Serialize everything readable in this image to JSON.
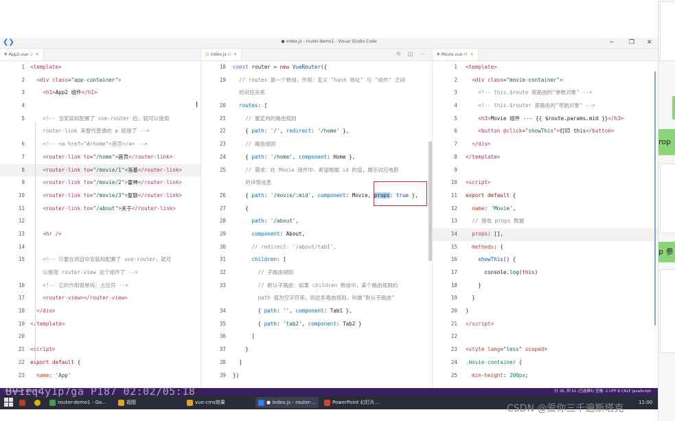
{
  "window": {
    "title": "● index.js - router-demo1 - Visual Studio Code",
    "controls": [
      "─",
      "❐",
      "✕"
    ]
  },
  "panes": [
    {
      "tab": {
        "icon": "▼",
        "label": "App2.vue",
        "status": "U",
        "close": "✕"
      },
      "lines": [
        {
          "n": "1",
          "html": "<span class='tag'>&lt;template&gt;</span>"
        },
        {
          "n": "2",
          "html": "  <span class='tag'>&lt;div</span> <span class='attr'>class</span>=<span class='str'>\"app-container\"</span><span class='tag'>&gt;</span>"
        },
        {
          "n": "3",
          "html": "    <span class='tag'>&lt;h1&gt;</span>App2 组件<span class='tag'>&lt;/h1&gt;</span>"
        },
        {
          "n": "4",
          "html": ""
        },
        {
          "n": "5",
          "html": "    <span class='cm'>&lt;!-- 当安装和配置了 vue-router 后，就可以使用</span>"
        },
        {
          "n": "",
          "html": "    <span class='cm'>router-link 来替代普通的 a 链接了 --&gt;</span>"
        },
        {
          "n": "6",
          "html": "    <span class='cm'>&lt;!-- &lt;a href=\"#/home\"&gt;首页&lt;/a&gt; --&gt;</span>"
        },
        {
          "n": "7",
          "html": "    <span class='tag'>&lt;router-link</span> <span class='attr'>to</span>=<span class='str'>\"/home\"</span><span class='tag'>&gt;</span>首页<span class='tag'>&lt;/router-link&gt;</span>"
        },
        {
          "n": "8",
          "html": "    <span class='tag'>&lt;router-link</span> <span class='attr'>to</span>=<span class='str'>\"/movie/1\"</span><span class='tag'>&gt;</span>洛基<span class='tag'>&lt;/router-link&gt;</span>",
          "hl": true
        },
        {
          "n": "9",
          "html": "    <span class='tag'>&lt;router-link</span> <span class='attr'>to</span>=<span class='str'>\"/movie/2\"</span><span class='tag'>&gt;</span>雷神<span class='tag'>&lt;/router-link&gt;</span>"
        },
        {
          "n": "10",
          "html": "    <span class='tag'>&lt;router-link</span> <span class='attr'>to</span>=<span class='str'>\"/movie/3\"</span><span class='tag'>&gt;</span>复联<span class='tag'>&lt;/router-link&gt;</span>"
        },
        {
          "n": "11",
          "html": "    <span class='tag'>&lt;router-link</span> <span class='attr'>to</span>=<span class='str'>\"/about\"</span><span class='tag'>&gt;</span>关于<span class='tag'>&lt;/router-link&gt;</span>"
        },
        {
          "n": "12",
          "html": ""
        },
        {
          "n": "13",
          "html": "    <span class='tag'>&lt;hr /&gt;</span>"
        },
        {
          "n": "14",
          "html": ""
        },
        {
          "n": "15",
          "html": "    <span class='cm'>&lt;!-- 只要在项目中安装和配置了 vue-router，就可</span>"
        },
        {
          "n": "",
          "html": "    <span class='cm'>以使用 router-view 这个组件了 --&gt;</span>"
        },
        {
          "n": "16",
          "html": "    <span class='cm'>&lt;!-- 它的作用很单纯：占位符 --&gt;</span>"
        },
        {
          "n": "17",
          "html": "    <span class='tag'>&lt;router-view&gt;&lt;/router-view&gt;</span>"
        },
        {
          "n": "18",
          "html": "  <span class='tag'>&lt;/div&gt;</span>"
        },
        {
          "n": "19",
          "html": "<span class='tag'>&lt;/template&gt;</span>"
        },
        {
          "n": "20",
          "html": ""
        },
        {
          "n": "21",
          "html": "<span class='tag'>&lt;script&gt;</span>"
        },
        {
          "n": "22",
          "html": "<span class='kw'>export default</span> {"
        },
        {
          "n": "23",
          "html": "  <span class='attr'>name</span>: <span class='str'>'App'</span>"
        }
      ]
    },
    {
      "tab": {
        "icon": "JS",
        "label": "index.js",
        "status": "U",
        "close": "✕"
      },
      "lines": [
        {
          "n": "18",
          "html": "<span class='kwb'>const</span> router = <span class='kw'>new</span> <span class='blu'>VueRouter</span>({"
        },
        {
          "n": "19",
          "html": "  <span class='cm'>// routes 是一个数组，作用：定义 \"hash 地址\" 与 \"组件\" 之间</span>"
        },
        {
          "n": "",
          "html": "  <span class='cm'>的对应关系</span>"
        },
        {
          "n": "20",
          "html": "  <span class='key'>routes</span>: ["
        },
        {
          "n": "21",
          "html": "    <span class='cm'>// 重定向的路由规则</span>"
        },
        {
          "n": "22",
          "html": "    { <span class='key'>path</span>: <span class='str'>'/'</span>, <span class='key'>redirect</span>: <span class='str'>'/home'</span> },"
        },
        {
          "n": "23",
          "html": "    <span class='cm'>// 路由规则</span>"
        },
        {
          "n": "24",
          "html": "    { <span class='key'>path</span>: <span class='str'>'/home'</span>, <span class='key'>component</span>: Home },"
        },
        {
          "n": "25",
          "html": "    <span class='cm'>// 需求：在 Movie 组件中，希望根据 id 的值，展示对应电影</span>"
        },
        {
          "n": "",
          "html": "    <span class='cm'>的详情信息</span>"
        },
        {
          "n": "26",
          "html": "    { <span class='key'>path</span>: <span class='str'>'/movie/:mid'</span>, <span class='key'>component</span>: Movie, <span class='sel'>props</span>: <span class='blu'>true</span> },"
        },
        {
          "n": "27",
          "html": "    {"
        },
        {
          "n": "28",
          "html": "      <span class='key'>path</span>: <span class='str'>'/about'</span>,"
        },
        {
          "n": "29",
          "html": "      <span class='key'>component</span>: About,"
        },
        {
          "n": "30",
          "html": "      <span class='cm'>// redirect: '/about/tab1',</span>"
        },
        {
          "n": "31",
          "html": "      <span class='key'>children</span>: ["
        },
        {
          "n": "32",
          "html": "        <span class='cm'>// 子路由规则</span>"
        },
        {
          "n": "33",
          "html": "        <span class='cm'>// 默认子路由：如果 children 数组中，某个路由规则的</span>"
        },
        {
          "n": "",
          "html": "        <span class='cm'>path 值为空字符串，则这条路由规则，叫做\"默认子路由\"</span>"
        },
        {
          "n": "34",
          "html": "        { <span class='key'>path</span>: <span class='str'>''</span>, <span class='key'>component</span>: Tab1 },"
        },
        {
          "n": "35",
          "html": "        { <span class='key'>path</span>: <span class='str'>'tab2'</span>, <span class='key'>component</span>: Tab2 }"
        },
        {
          "n": "36",
          "html": "      ]"
        },
        {
          "n": "37",
          "html": "    }"
        },
        {
          "n": "38",
          "html": "  ]"
        },
        {
          "n": "39",
          "html": "})"
        }
      ]
    },
    {
      "tab": {
        "icon": "▼",
        "label": "Movie.vue",
        "status": "M",
        "close": "✕"
      },
      "lines": [
        {
          "n": "1",
          "html": "<span class='tag'>&lt;template&gt;</span>"
        },
        {
          "n": "2",
          "html": "  <span class='tag'>&lt;div</span> <span class='attr'>class</span>=<span class='str'>\"movie-container\"</span><span class='tag'>&gt;</span>"
        },
        {
          "n": "3",
          "html": "    <span class='cm'>&lt;!-- this.$route 是路由的\"参数对象\" --&gt;</span>"
        },
        {
          "n": "4",
          "html": "    <span class='cm'>&lt;!-- this.$router 是路由的\"导航对象\" --&gt;</span>"
        },
        {
          "n": "5",
          "html": "    <span class='tag'>&lt;h3&gt;</span>Movie 组件 --- {{ $route.params.mid }}<span class='tag'>&lt;/h3&gt;</span>"
        },
        {
          "n": "6",
          "html": "    <span class='tag'>&lt;button</span> <span class='attr'>@click</span>=<span class='str'>\"showThis\"</span><span class='tag'>&gt;</span>打印 this<span class='tag'>&lt;/button&gt;</span>"
        },
        {
          "n": "7",
          "html": "  <span class='tag'>&lt;/div&gt;</span>"
        },
        {
          "n": "8",
          "html": "<span class='tag'>&lt;/template&gt;</span>"
        },
        {
          "n": "9",
          "html": ""
        },
        {
          "n": "10",
          "html": "<span class='tag'>&lt;script&gt;</span>"
        },
        {
          "n": "11",
          "html": "<span class='kw'>export default</span> {"
        },
        {
          "n": "12",
          "html": "  <span class='attr'>name</span>: <span class='str'>'Movie'</span>,"
        },
        {
          "n": "13",
          "html": "  <span class='cm'>// 接收 props 数据</span>"
        },
        {
          "n": "14",
          "html": "  <span class='attr'>props</span>: [],",
          "hl": true
        },
        {
          "n": "15",
          "html": "  <span class='attr'>methods</span>: {"
        },
        {
          "n": "16",
          "html": "    <span class='blu'>showThis</span>() {"
        },
        {
          "n": "17",
          "html": "      console.<span class='blu'>log</span>(<span class='kw'>this</span>)"
        },
        {
          "n": "18",
          "html": "    }"
        },
        {
          "n": "19",
          "html": "  }"
        },
        {
          "n": "20",
          "html": "}"
        },
        {
          "n": "21",
          "html": "<span class='tag'>&lt;/script&gt;</span>"
        },
        {
          "n": "22",
          "html": ""
        },
        {
          "n": "23",
          "html": "<span class='tag'>&lt;style</span> <span class='attr'>lang</span>=<span class='str'>\"less\"</span> <span class='attr'>scoped</span><span class='tag'>&gt;</span>"
        },
        {
          "n": "24",
          "html": "<span class='num2'>.movie-container</span> {"
        },
        {
          "n": "25",
          "html": "  <span class='attr'>min-height</span>: <span class='num2'>200px</span>;"
        }
      ]
    }
  ],
  "statusbar": {
    "left": "ⓧ master*  ⊗ 0 ⚠ 0",
    "right": "行 26, 列 51 (已选择5)   空格: 2   UTF-8   CRLF   JavaScript"
  },
  "taskbar": {
    "items": [
      {
        "label": "router-demo1 - Go...",
        "color": "#3fa34d"
      },
      {
        "label": "视图",
        "color": "#e0a526"
      },
      {
        "label": "vue-cms效果",
        "color": "#e0a526"
      },
      {
        "label": "● index.js - router-...",
        "color": "#2f80ed"
      },
      {
        "label": "PowerPoint 幻灯片...",
        "color": "#d24726"
      }
    ],
    "clock": "11:00"
  },
  "right_panel": {
    "snippet1": "rop",
    "snippet2": "p 参"
  },
  "video_overlay": "BV1zq4y1p7ga P187 02:02/05:18",
  "watermark": "CSDN @爱你三千遍斯塔克"
}
